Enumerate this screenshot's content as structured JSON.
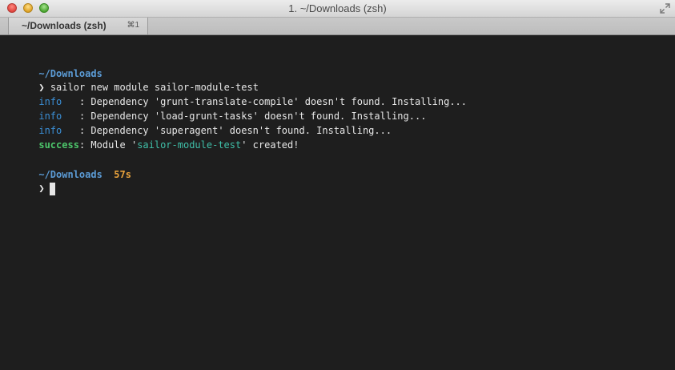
{
  "window": {
    "title": "1. ~/Downloads (zsh)"
  },
  "tab": {
    "label": "~/Downloads (zsh)",
    "shortcut": "⌘1"
  },
  "terminal": {
    "prompt_symbol": "❯",
    "block1": {
      "dir": "~/Downloads",
      "command": "sailor new module sailor-module-test",
      "logs": [
        {
          "level": "info",
          "sep": "   : ",
          "message": "Dependency 'grunt-translate-compile' doesn't found. Installing..."
        },
        {
          "level": "info",
          "sep": "   : ",
          "message": "Dependency 'load-grunt-tasks' doesn't found. Installing..."
        },
        {
          "level": "info",
          "sep": "   : ",
          "message": "Dependency 'superagent' doesn't found. Installing..."
        }
      ],
      "success": {
        "level": "success",
        "sep": ": ",
        "prefix": "Module '",
        "module": "sailor-module-test",
        "suffix": "' created!"
      }
    },
    "block2": {
      "dir": "~/Downloads",
      "duration": "57s"
    }
  },
  "colors": {
    "background": "#1e1e1e",
    "directory": "#5b9bd5",
    "info": "#3b8fd6",
    "success": "#4cc46a",
    "module_name": "#3fbfa8",
    "duration": "#e8a23c"
  }
}
